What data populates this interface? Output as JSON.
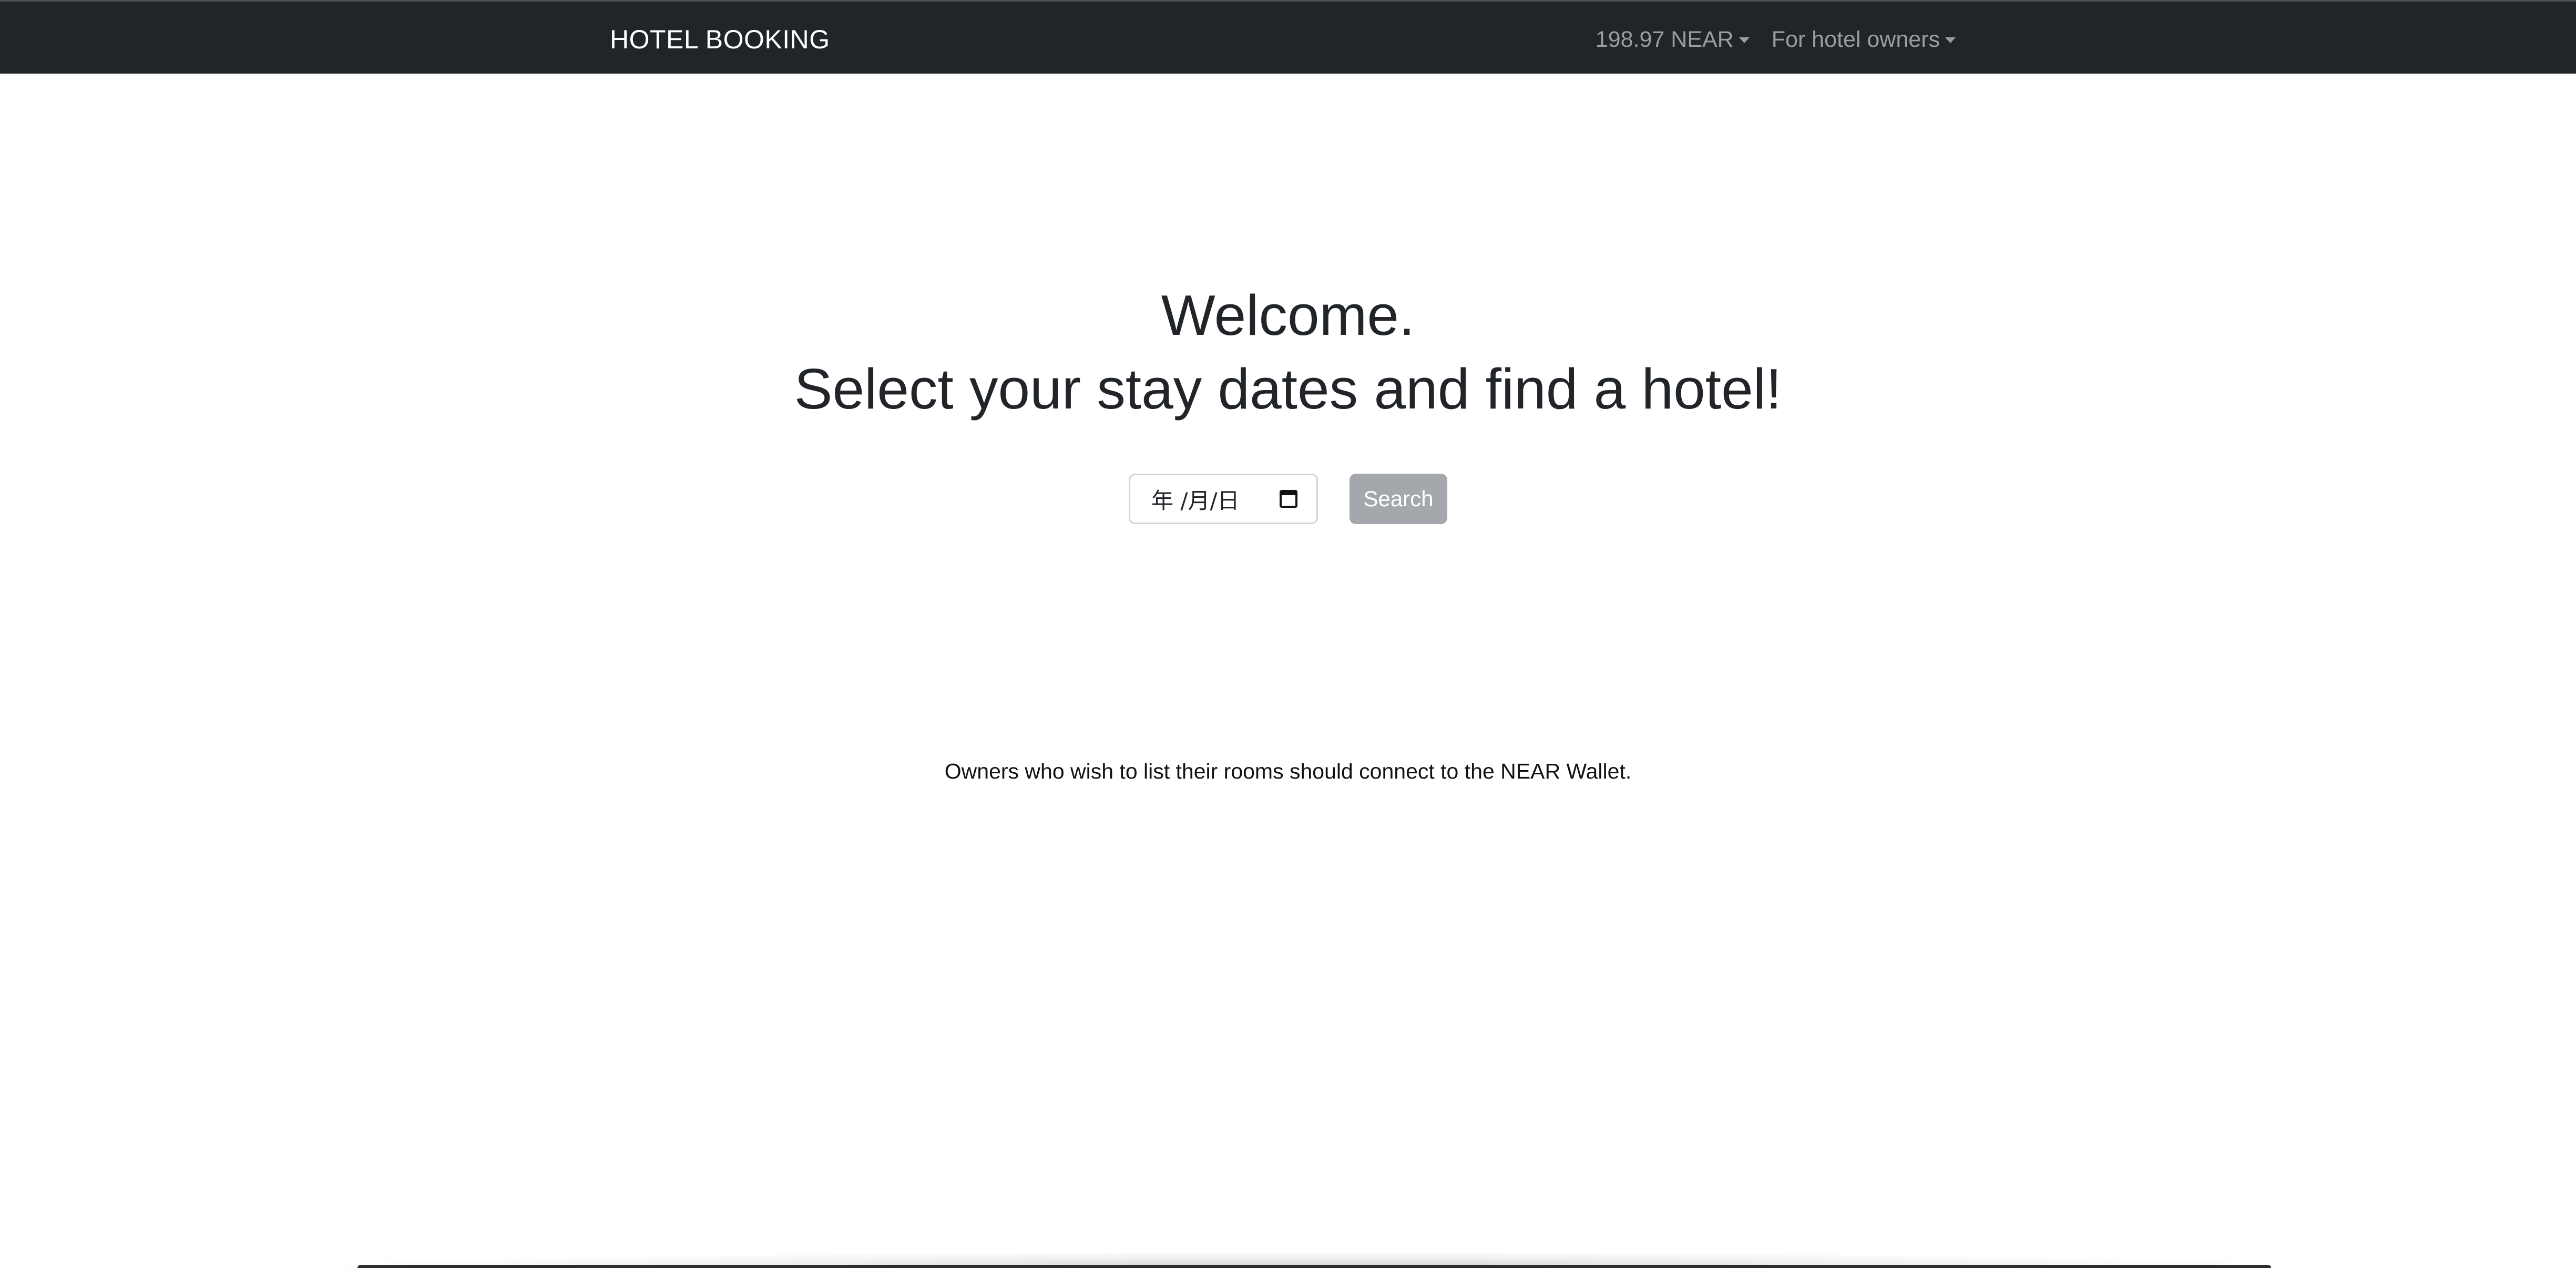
{
  "navbar": {
    "brand": "HOTEL BOOKING",
    "balance_label": "198.97 NEAR",
    "owners_menu_label": "For hotel owners",
    "icons": {
      "balance_dropdown": "caret-down-icon",
      "owners_dropdown": "caret-down-icon"
    }
  },
  "hero": {
    "title_line_1": "Welcome.",
    "title_line_2": "Select your stay dates and find a hotel!"
  },
  "search": {
    "date_display": "年 /月/日",
    "button_label": "Search",
    "calendar_icon": "calendar-icon"
  },
  "footer_note": {
    "text": "Owners who wish to list their rooms should connect to the NEAR Wallet."
  },
  "colors": {
    "navbar_bg": "#212529",
    "brand_text": "#ffffff",
    "nav_text": "#a6a8ab",
    "button_bg": "#a4a8ad",
    "page_bg": "#ffffff"
  }
}
